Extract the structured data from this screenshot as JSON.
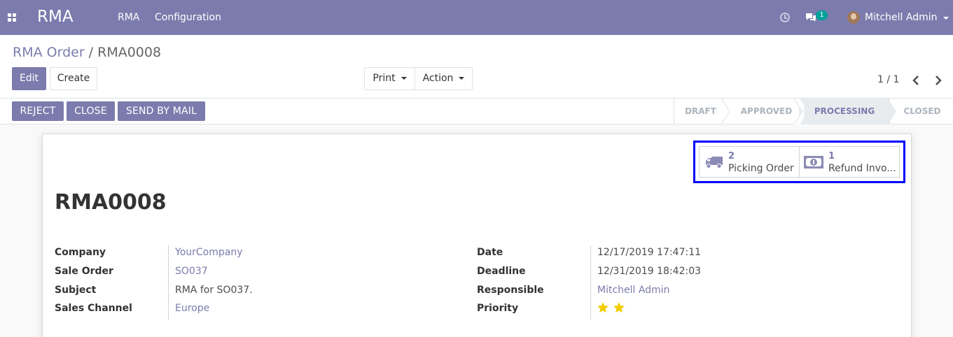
{
  "navbar": {
    "app_title": "RMA",
    "menu": [
      "RMA",
      "Configuration"
    ],
    "chat_count": "1",
    "user_name": "Mitchell Admin",
    "bg_color": "#7c7bad"
  },
  "breadcrumb": {
    "parent": "RMA Order",
    "separator": " / ",
    "current": "RMA0008"
  },
  "buttons": {
    "edit": "Edit",
    "create": "Create",
    "print": "Print",
    "action": "Action"
  },
  "pager": {
    "value": "1 / 1"
  },
  "statusbar": {
    "actions": [
      "REJECT",
      "CLOSE",
      "SEND BY MAIL"
    ],
    "stages": [
      "DRAFT",
      "APPROVED",
      "PROCESSING",
      "CLOSED"
    ],
    "active_stage": "PROCESSING"
  },
  "smart_buttons": [
    {
      "value": "2",
      "label": "Picking Order",
      "icon": "truck-icon"
    },
    {
      "value": "1",
      "label": "Refund Invo...",
      "icon": "money-icon"
    }
  ],
  "record": {
    "name": "RMA0008"
  },
  "fields": {
    "company": {
      "label": "Company",
      "value": "YourCompany"
    },
    "sale_order": {
      "label": "Sale Order",
      "value": "SO037"
    },
    "subject": {
      "label": "Subject",
      "value": "RMA for SO037."
    },
    "sales_channel": {
      "label": "Sales Channel",
      "value": "Europe"
    },
    "date": {
      "label": "Date",
      "value": "12/17/2019 17:47:11"
    },
    "deadline": {
      "label": "Deadline",
      "value": "12/31/2019 18:42:03"
    },
    "responsible": {
      "label": "Responsible",
      "value": "Mitchell Admin"
    },
    "priority": {
      "label": "Priority",
      "stars_filled": 2,
      "stars_total": 2
    }
  }
}
